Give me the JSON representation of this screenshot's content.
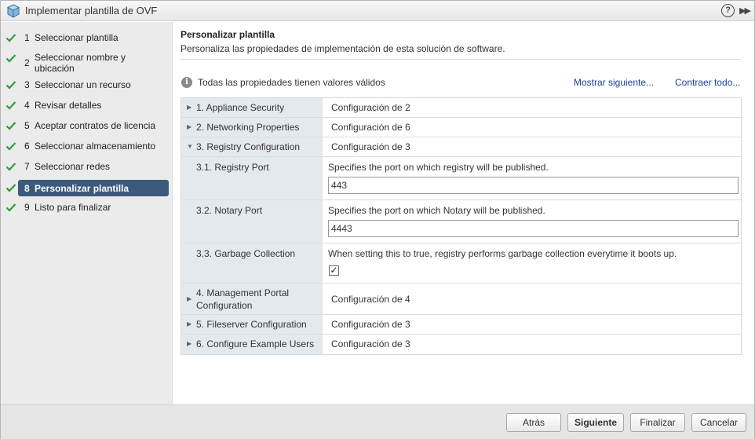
{
  "window": {
    "title": "Implementar plantilla de OVF"
  },
  "steps": [
    {
      "num": "1",
      "label": "Seleccionar plantilla",
      "done": true
    },
    {
      "num": "2",
      "label": "Seleccionar nombre y ubicación",
      "done": true
    },
    {
      "num": "3",
      "label": "Seleccionar un recurso",
      "done": true
    },
    {
      "num": "4",
      "label": "Revisar detalles",
      "done": true
    },
    {
      "num": "5",
      "label": "Aceptar contratos de licencia",
      "done": true
    },
    {
      "num": "6",
      "label": "Seleccionar almacenamiento",
      "done": true
    },
    {
      "num": "7",
      "label": "Seleccionar redes",
      "done": true
    },
    {
      "num": "8",
      "label": "Personalizar plantilla",
      "done": true,
      "active": true
    },
    {
      "num": "9",
      "label": "Listo para finalizar",
      "done": true
    }
  ],
  "main": {
    "title": "Personalizar plantilla",
    "description": "Personaliza las propiedades de implementación de esta solución de software.",
    "status": "Todas las propiedades tienen valores válidos",
    "show_next": "Mostrar siguiente...",
    "collapse_all": "Contraer todo..."
  },
  "properties": {
    "r1": {
      "label": "1. Appliance Security",
      "value": "Configuración de 2"
    },
    "r2": {
      "label": "2. Networking Properties",
      "value": "Configuración de 6"
    },
    "r3": {
      "label": "3. Registry Configuration",
      "value": "Configuración de 3"
    },
    "r31": {
      "label": "3.1. Registry Port",
      "desc": "Specifies the port on which registry will be published.",
      "value": "443"
    },
    "r32": {
      "label": "3.2. Notary Port",
      "desc": "Specifies the port on which Notary will be published.",
      "value": "4443"
    },
    "r33": {
      "label": "3.3. Garbage Collection",
      "desc": "When setting this to true, registry performs garbage collection everytime it boots up.",
      "checked": true
    },
    "r4": {
      "label": "4. Management Portal Configuration",
      "value": "Configuración de 4"
    },
    "r5": {
      "label": "5. Fileserver Configuration",
      "value": "Configuración de 3"
    },
    "r6": {
      "label": "6. Configure Example Users",
      "value": "Configuración de 3"
    }
  },
  "footer": {
    "back": "Atrás",
    "next": "Siguiente",
    "finish": "Finalizar",
    "cancel": "Cancelar"
  },
  "colors": {
    "accent": "#3c5a7c",
    "check": "#2e9e3a",
    "link": "#1a3f9b"
  }
}
